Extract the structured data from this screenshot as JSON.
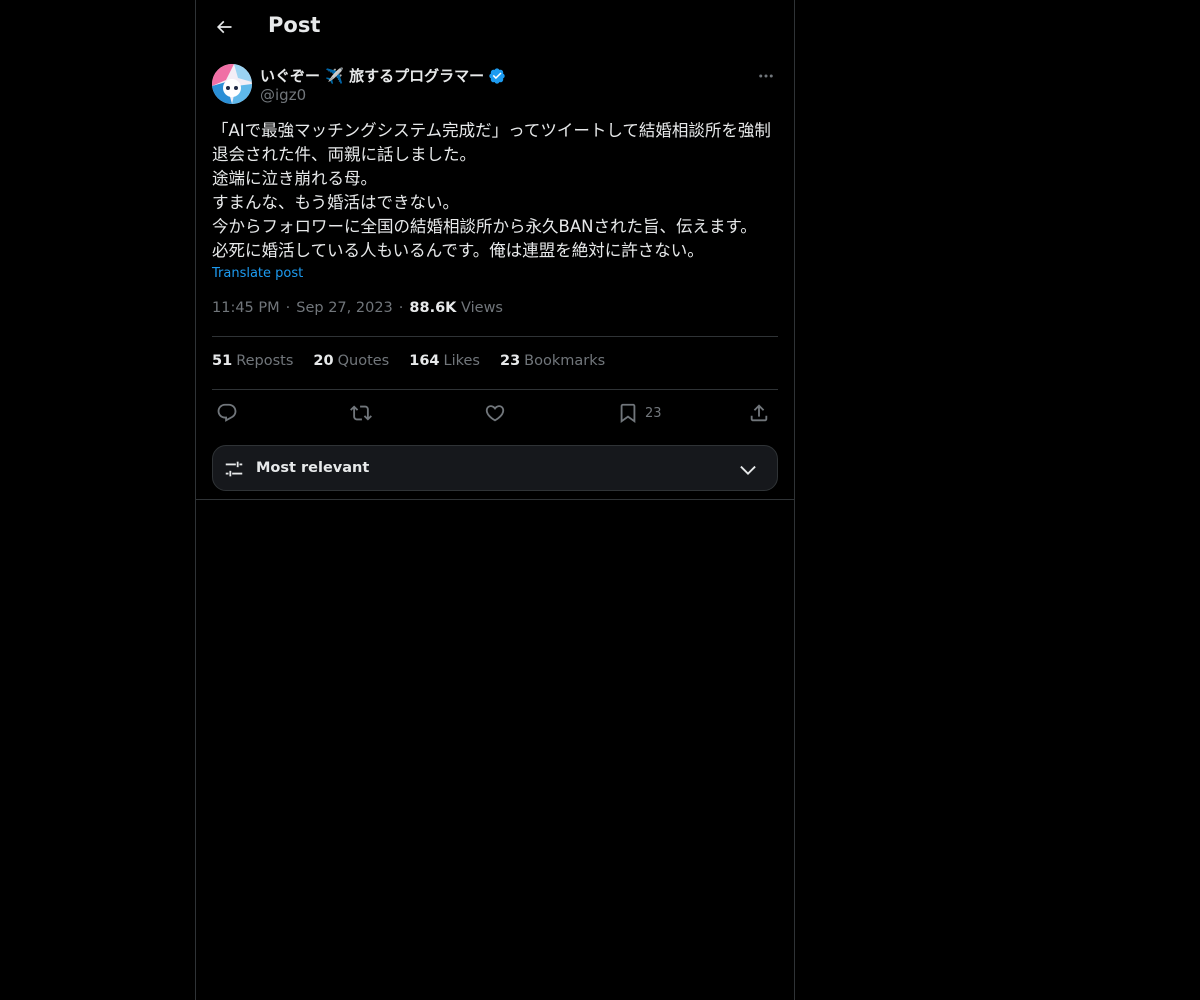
{
  "header": {
    "title": "Post"
  },
  "author": {
    "display_name": "いぐぞー ✈️ 旅するプログラマー",
    "handle": "@igz0",
    "verified": true
  },
  "post": {
    "text": "「AIで最強マッチングシステム完成だ」ってツイートして結婚相談所を強制退会された件、両親に話しました。\n途端に泣き崩れる母。\nすまんな、もう婚活はできない。\n今からフォロワーに全国の結婚相談所から永久BANされた旨、伝えます。\n必死に婚活している人もいるんです。俺は連盟を絶対に許さない。",
    "translate_label": "Translate post",
    "time": "11:45 PM",
    "date": "Sep 27, 2023",
    "views_count": "88.6K",
    "views_label": "Views"
  },
  "stats": [
    {
      "count": "51",
      "label": "Reposts"
    },
    {
      "count": "20",
      "label": "Quotes"
    },
    {
      "count": "164",
      "label": "Likes"
    },
    {
      "count": "23",
      "label": "Bookmarks"
    }
  ],
  "actions": {
    "reply_icon": "reply-icon",
    "repost_icon": "repost-icon",
    "like_icon": "heart-icon",
    "bookmark_icon": "bookmark-icon",
    "bookmark_count": "23",
    "share_icon": "share-icon"
  },
  "sort": {
    "label": "Most relevant"
  },
  "colors": {
    "background": "#000000",
    "text": "#e7e9ea",
    "muted": "#71767b",
    "accent": "#1d9bf0",
    "border": "#2f3336"
  }
}
